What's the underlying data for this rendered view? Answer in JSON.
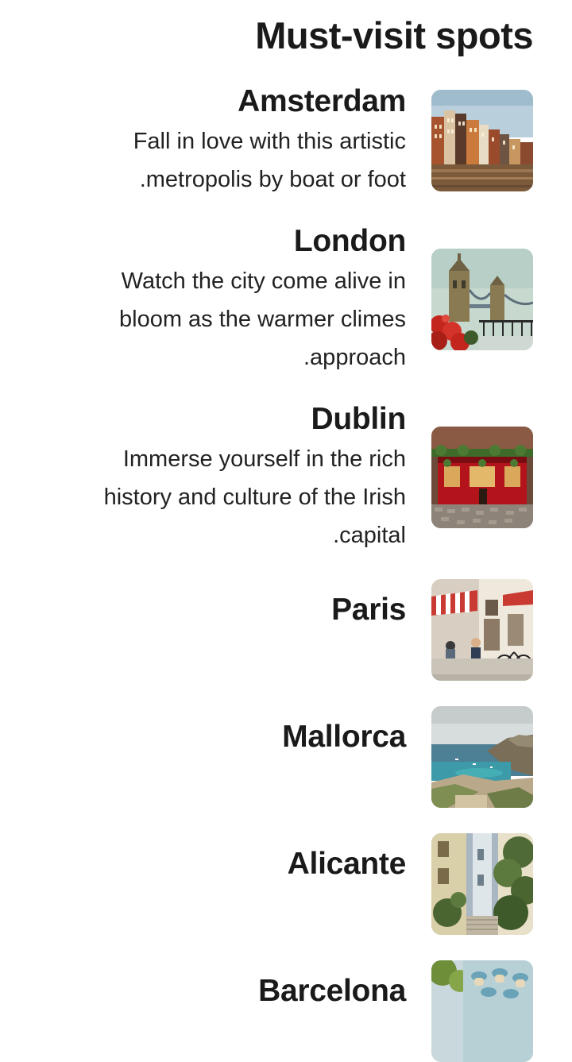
{
  "header": {
    "title": "Must-visit spots"
  },
  "spots": [
    {
      "name": "Amsterdam",
      "description_lines": [
        "Fall in love with this artistic",
        ".metropolis by boat or foot"
      ],
      "image": "amsterdam-canal-houses-photo"
    },
    {
      "name": "London",
      "description_lines": [
        "Watch the city come alive in",
        "bloom as the warmer climes",
        ".approach"
      ],
      "image": "tower-bridge-photo"
    },
    {
      "name": "Dublin",
      "description_lines": [
        "Immerse yourself in the rich",
        "history and culture of the Irish",
        ".capital"
      ],
      "image": "temple-bar-pub-photo"
    },
    {
      "name": "Paris",
      "description_lines": [],
      "image": "paris-cafe-street-photo"
    },
    {
      "name": "Mallorca",
      "description_lines": [],
      "image": "mallorca-coast-photo"
    },
    {
      "name": "Alicante",
      "description_lines": [],
      "image": "alicante-alley-photo"
    },
    {
      "name": "Barcelona",
      "description_lines": [],
      "image": "barcelona-casa-batllo-photo"
    }
  ],
  "colors": {
    "text": "#1a1a1a",
    "background": "#ffffff"
  }
}
